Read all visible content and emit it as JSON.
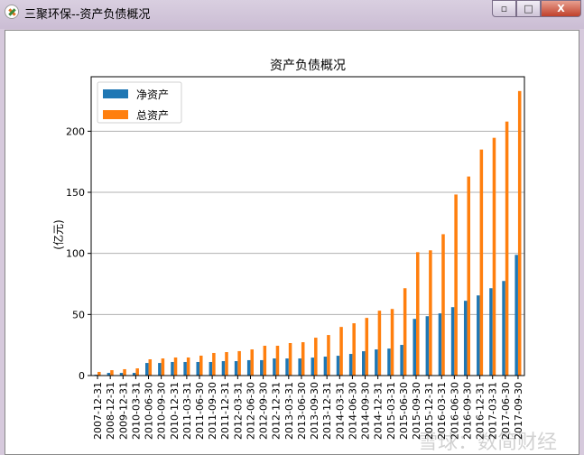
{
  "window": {
    "title": "三聚环保--资产负债概况",
    "minimize_icon": "minimize-icon",
    "maximize_icon": "maximize-icon",
    "close_icon": "close-icon"
  },
  "watermark": "雪球：数简财经",
  "chart_data": {
    "type": "bar",
    "title": "资产负债概况",
    "xlabel": "",
    "ylabel": "(亿元)",
    "ylim": [
      0,
      244.6
    ],
    "yticks": [
      0,
      50,
      100,
      150,
      200
    ],
    "grid": "y",
    "legend_placement": "upper-left",
    "categories": [
      "2007-12-31",
      "2008-12-31",
      "2009-12-31",
      "2010-03-31",
      "2010-06-30",
      "2010-09-30",
      "2010-12-31",
      "2011-03-31",
      "2011-06-30",
      "2011-09-30",
      "2011-12-31",
      "2012-03-31",
      "2012-06-30",
      "2012-09-30",
      "2012-12-31",
      "2013-03-31",
      "2013-06-30",
      "2013-09-30",
      "2013-12-31",
      "2014-03-31",
      "2014-06-30",
      "2014-09-30",
      "2014-12-31",
      "2015-03-31",
      "2015-06-30",
      "2015-09-30",
      "2015-12-31",
      "2016-03-31",
      "2016-06-30",
      "2016-09-30",
      "2016-12-31",
      "2017-03-31",
      "2017-06-30",
      "2017-09-30"
    ],
    "series": [
      {
        "name": "净资产",
        "color": "#1f77b4",
        "values": [
          0.7,
          2.2,
          2.2,
          2.2,
          10.3,
          10.3,
          11.1,
          11.1,
          11.1,
          11.1,
          11.8,
          11.8,
          12.6,
          12.6,
          14.0,
          14.0,
          14.0,
          14.7,
          15.5,
          16.2,
          17.7,
          19.9,
          21.4,
          22.1,
          25.1,
          46.4,
          48.6,
          50.9,
          56.0,
          61.2,
          65.6,
          71.5,
          77.4,
          98.8
        ]
      },
      {
        "name": "总资产",
        "color": "#ff7f0e",
        "values": [
          3.0,
          4.4,
          5.2,
          5.9,
          13.3,
          14.0,
          14.8,
          14.8,
          16.3,
          18.5,
          19.2,
          20.0,
          21.4,
          24.4,
          24.4,
          26.6,
          27.3,
          31.0,
          33.2,
          39.8,
          42.8,
          47.2,
          53.1,
          54.5,
          71.5,
          101.0,
          102.5,
          115.7,
          148.2,
          162.9,
          185.0,
          194.6,
          207.9,
          232.9
        ]
      }
    ]
  }
}
